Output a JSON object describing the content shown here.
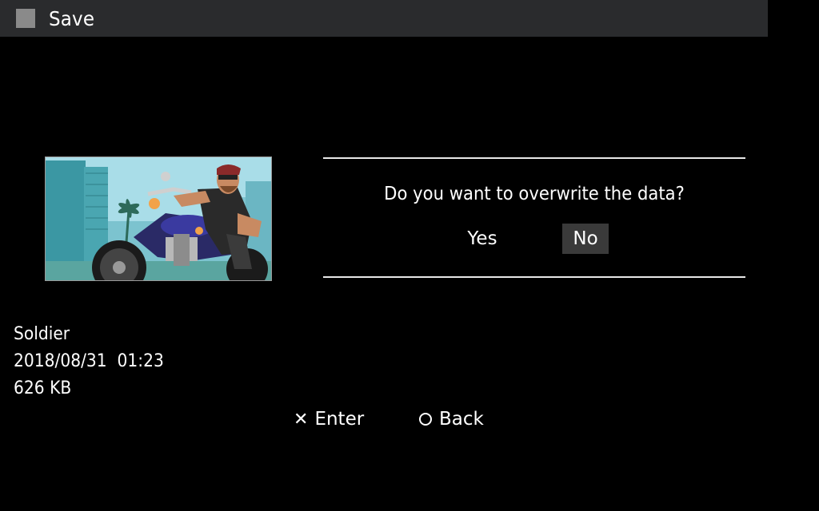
{
  "header": {
    "title": "Save",
    "icon": "save-square-icon"
  },
  "save_slot": {
    "name": "Soldier",
    "datetime": "2018/08/31  01:23",
    "size": "626 KB",
    "thumbnail": "game-thumbnail-biker"
  },
  "dialog": {
    "question": "Do you want to overwrite the data?",
    "yes_label": "Yes",
    "no_label": "No",
    "selected": "No"
  },
  "hints": {
    "enter_icon": "cross-button-icon",
    "enter_label": "Enter",
    "back_icon": "circle-button-icon",
    "back_label": "Back"
  },
  "colors": {
    "titlebar_bg": "#2a2b2d",
    "selected_bg": "#3a3a3a",
    "background": "#000000"
  }
}
